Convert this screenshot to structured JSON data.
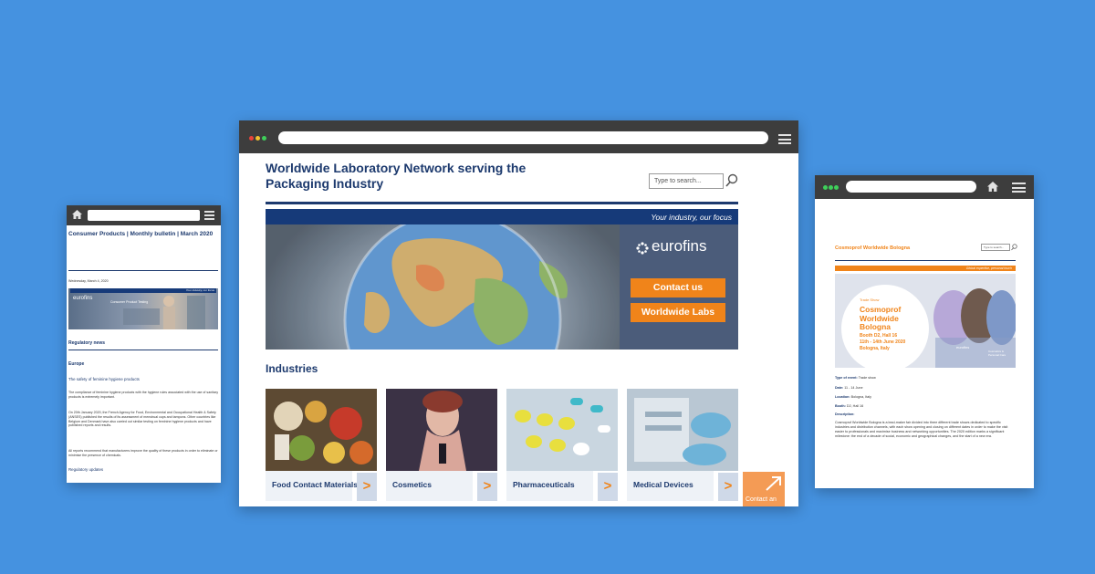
{
  "main_window": {
    "title": "Worldwide Laboratory Network serving the Packaging Industry",
    "search_placeholder": "Type to search...",
    "tagline": "Your industry, our focus",
    "logo_text": "eurofins",
    "contact_button": "Contact us",
    "labs_button": "Worldwide Labs",
    "industries_heading": "Industries",
    "tiles": [
      {
        "label": "Food Contact Materials",
        "arrow": ">"
      },
      {
        "label": "Cosmetics",
        "arrow": ">"
      },
      {
        "label": "Pharmaceuticals",
        "arrow": ">"
      },
      {
        "label": "Medical Devices",
        "arrow": ">"
      }
    ],
    "contact_corner": "Contact an"
  },
  "left_window": {
    "title": "Consumer Products | Monthly bulletin | March 2020",
    "date": "Wednesday, March 4, 2020",
    "banner_logo": "eurofins",
    "banner_sub": "Consumer Product Testing",
    "banner_tag": "Your industry, our focus",
    "section_regulatory": "Regulatory news",
    "region": "Europe",
    "article_title": "The safety of feminine hygiene products",
    "para1": "The compliance of feminine hygiene products with the hygiene rules associated with the use of sanitary products is extremely important.",
    "para2": "On 20th January 2020, the French Agency for Food, Environmental and Occupational Health & Safety (ANSES) published the results of its assessment of menstrual cups and tampons. Other countries like Belgium and Denmark have also carried out similar testing on feminine hygiene products and have published reports and results.",
    "para3": "All reports recommend that manufacturers improve the quality of these products in order to eliminate or minimise the presence of chemicals.",
    "link_updates": "Regulatory updates"
  },
  "right_window": {
    "title": "Cosmoprof Worldwide Bologna",
    "search_placeholder": "Type to search...",
    "strip_text": "Global expertise, personal touch",
    "banner": {
      "kicker": "Trade Show",
      "name": "Cosmoprof Worldwide Bologna",
      "booth": "Booth D2, Hall 16",
      "dates": "11th - 14th June 2020",
      "city": "Bologna, Italy",
      "logo": "eurofins",
      "badge": "Cosmetics & Personal Care"
    },
    "type_label": "Type of event:",
    "type_value": "Trade show",
    "date_label": "Date:",
    "date_value": "11 - 14 June",
    "location_label": "Location:",
    "location_value": "Bologna, Italy",
    "booth_label": "Booth:",
    "booth_value": "D2, Hall 16",
    "description_label": "Description:",
    "description": "Cosmoprof Worldwide Bologna is a lead-maker fair divided into three different trade shows dedicated to specific industries and distribution channels, with each show opening and closing on different dates in order to make the visit easier to professionals and maximise business and networking opportunities. The 2020 edition marks a significant milestone: the end of a decade of social, economic and geographical changes, and the start of a new era."
  },
  "colors": {
    "background": "#4592e0",
    "navy": "#1d3a6e",
    "orange": "#f0841a",
    "chrome": "#3d3d3d"
  }
}
